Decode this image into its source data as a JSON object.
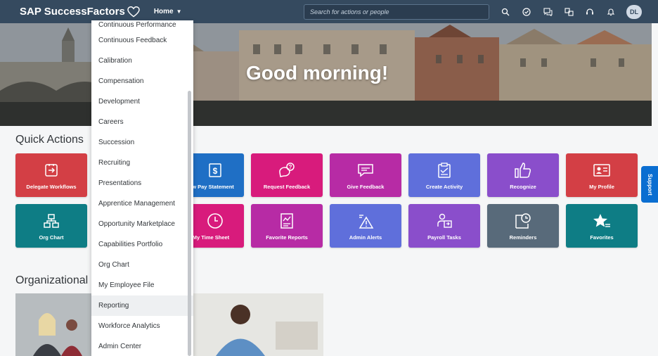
{
  "shell": {
    "brand": "SAP SuccessFactors",
    "home_label": "Home",
    "search_placeholder": "Search for actions or people",
    "avatar_initials": "DL",
    "icons": [
      "search-icon",
      "check-circle-icon",
      "chat-icon",
      "people-icon",
      "help-icon",
      "bell-icon"
    ]
  },
  "hero": {
    "greeting": "Good morning!"
  },
  "quick_actions": {
    "title": "Quick Actions",
    "tiles": [
      {
        "label": "Delegate Workflows",
        "icon": "delegate-icon",
        "color": "#d33f45"
      },
      {
        "label": "w Pay Statement",
        "icon": "pay-statement-icon",
        "color": "#1f6fc5"
      },
      {
        "label": "Request Feedback",
        "icon": "request-feedback-icon",
        "color": "#d81b7c"
      },
      {
        "label": "Give Feedback",
        "icon": "give-feedback-icon",
        "color": "#b72ba5"
      },
      {
        "label": "Create Activity",
        "icon": "clipboard-icon",
        "color": "#5f6fdb"
      },
      {
        "label": "Recognize",
        "icon": "thumbs-up-icon",
        "color": "#8a4ecb"
      },
      {
        "label": "My Profile",
        "icon": "profile-card-icon",
        "color": "#d33f45"
      },
      {
        "label": "Org Chart",
        "icon": "org-chart-icon",
        "color": "#0e7d85"
      },
      {
        "label": "My Time Sheet",
        "icon": "clock-icon",
        "color": "#d81b7c"
      },
      {
        "label": "Favorite Reports",
        "icon": "report-icon",
        "color": "#b72ba5"
      },
      {
        "label": "Admin Alerts",
        "icon": "alert-icon",
        "color": "#5f6fdb"
      },
      {
        "label": "Payroll Tasks",
        "icon": "payroll-icon",
        "color": "#8a4ecb"
      },
      {
        "label": "Reminders",
        "icon": "reminder-icon",
        "color": "#586a7a"
      },
      {
        "label": "Favorites",
        "icon": "star-icon",
        "color": "#0e7d85"
      }
    ]
  },
  "org_section": {
    "title": "Organizational U"
  },
  "menu": {
    "items": [
      "Continuous Performance",
      "Continuous Feedback",
      "Calibration",
      "Compensation",
      "Development",
      "Careers",
      "Succession",
      "Recruiting",
      "Presentations",
      "Apprentice Management",
      "Opportunity Marketplace",
      "Capabilities Portfolio",
      "Org Chart",
      "My Employee File",
      "Reporting",
      "Workforce Analytics",
      "Admin Center"
    ],
    "highlighted": "Reporting"
  },
  "support_label": "Support"
}
